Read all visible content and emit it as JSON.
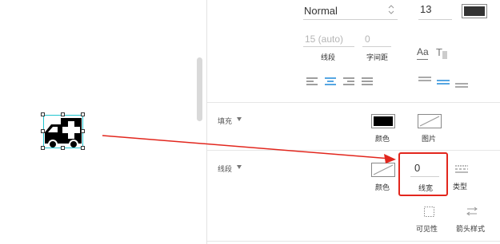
{
  "text": {
    "font_name": "Normal",
    "font_size": "13",
    "line_height_value": "15 (auto)",
    "letter_spacing_value": "0",
    "line_height_label": "线段",
    "letter_spacing_label": "字间距",
    "text_case_glyph": "Aa",
    "text_style_glyph": "T",
    "text_color_hex": "#333333"
  },
  "fill": {
    "section_label": "填充",
    "color_label": "颜色",
    "image_label": "图片",
    "color_hex": "#000000"
  },
  "stroke": {
    "section_label": "线段",
    "color_label": "颜色",
    "width_value": "0",
    "width_label": "线宽",
    "type_label": "类型",
    "visibility_label": "可见性",
    "arrow_style_label": "箭头样式"
  },
  "colors": {
    "highlight_red": "#e2261d",
    "selection_cyan": "#21c4cf",
    "accent_blue": "#1e88d8"
  },
  "icons": {
    "selected_shape": "ambulance-icon"
  }
}
